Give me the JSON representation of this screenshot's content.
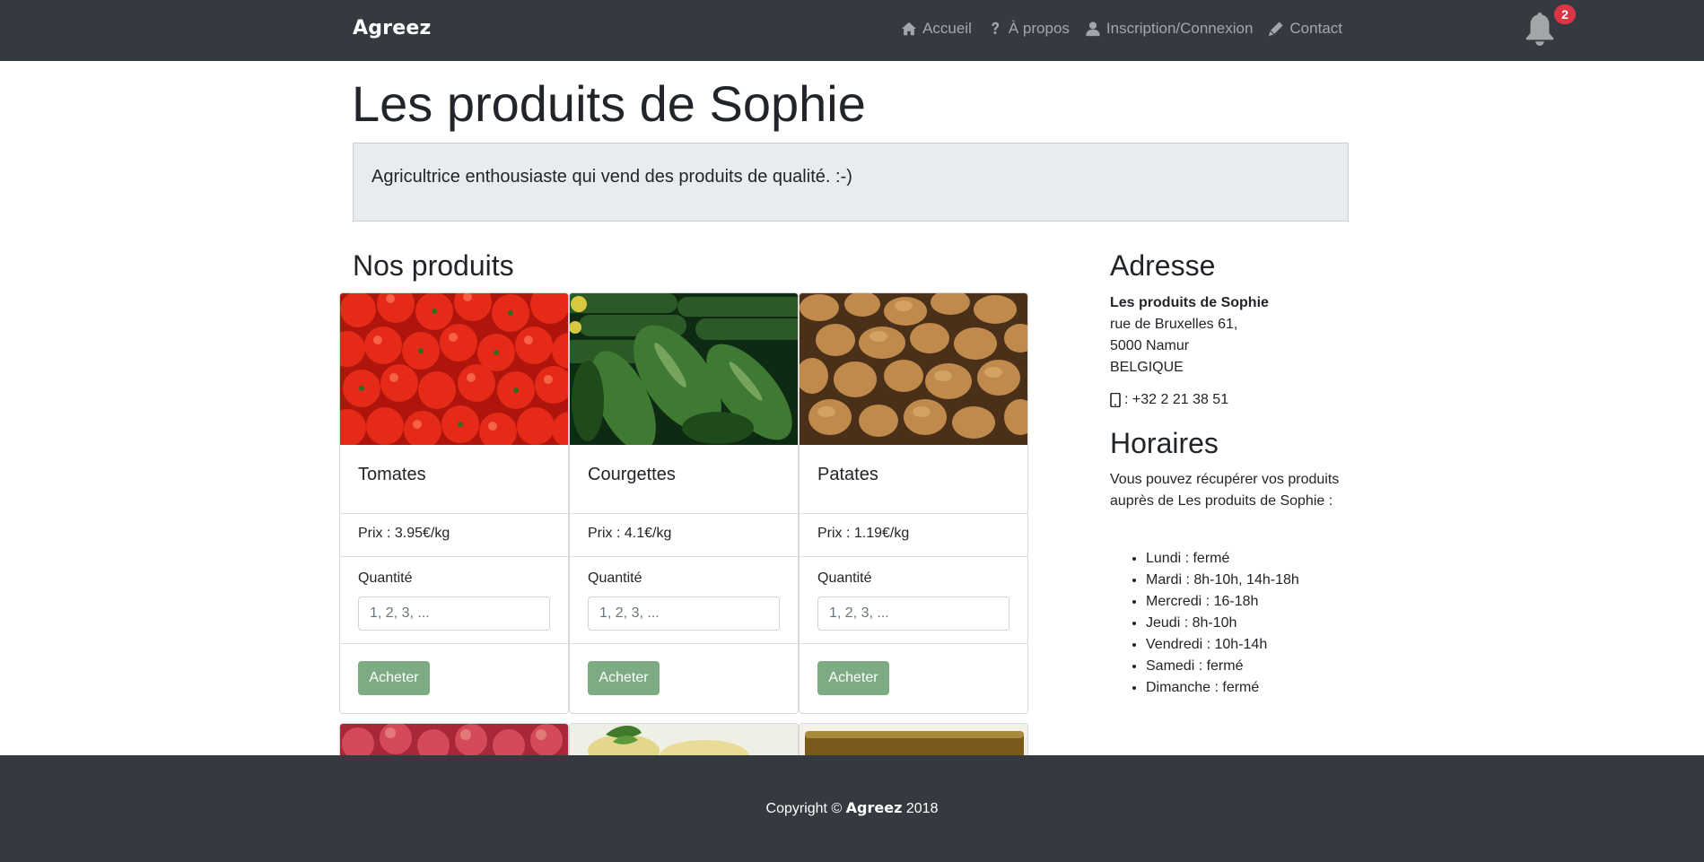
{
  "navbar": {
    "brand": "Agreez",
    "links": [
      {
        "label": "Accueil",
        "icon": "home-icon"
      },
      {
        "label": "À propos",
        "icon": "question-icon"
      },
      {
        "label": "Inscription/Connexion",
        "icon": "user-icon"
      },
      {
        "label": "Contact",
        "icon": "pen-icon"
      }
    ],
    "notifications_count": "2"
  },
  "page": {
    "title": "Les produits de Sophie",
    "description": "Agricultrice enthousiaste qui vend des produits de qualité. :-)"
  },
  "products_section": {
    "title": "Nos produits",
    "quantity_label": "Quantité",
    "quantity_placeholder": "1, 2, 3, ...",
    "buy_label": "Acheter",
    "items": [
      {
        "name": "Tomates",
        "price": "Prix : 3.95€/kg",
        "image": "tomatoes"
      },
      {
        "name": "Courgettes",
        "price": "Prix : 4.1€/kg",
        "image": "zucchini"
      },
      {
        "name": "Patates",
        "price": "Prix : 1.19€/kg",
        "image": "potatoes"
      }
    ]
  },
  "sidebar": {
    "address_title": "Adresse",
    "address": {
      "name": "Les produits de Sophie",
      "street": "rue de Bruxelles 61,",
      "city": "5000 Namur",
      "country": "BELGIQUE",
      "phone": ": +32 2 21 38 51"
    },
    "hours_title": "Horaires",
    "hours_intro": "Vous pouvez récupérer vos produits auprès de Les produits de Sophie :",
    "hours": [
      "Lundi : fermé",
      "Mardi : 8h-10h, 14h-18h",
      "Mercredi : 16-18h",
      "Jeudi : 8h-10h",
      "Vendredi : 10h-14h",
      "Samedi : fermé",
      "Dimanche : fermé"
    ]
  },
  "footer": {
    "prefix": "Copyright © ",
    "brand": "Agreez",
    "year": " 2018"
  },
  "colors": {
    "navbar_bg": "#343a40",
    "buy_button": "#7dab84",
    "badge": "#dc3545",
    "jumbotron_bg": "#e9ecef"
  }
}
